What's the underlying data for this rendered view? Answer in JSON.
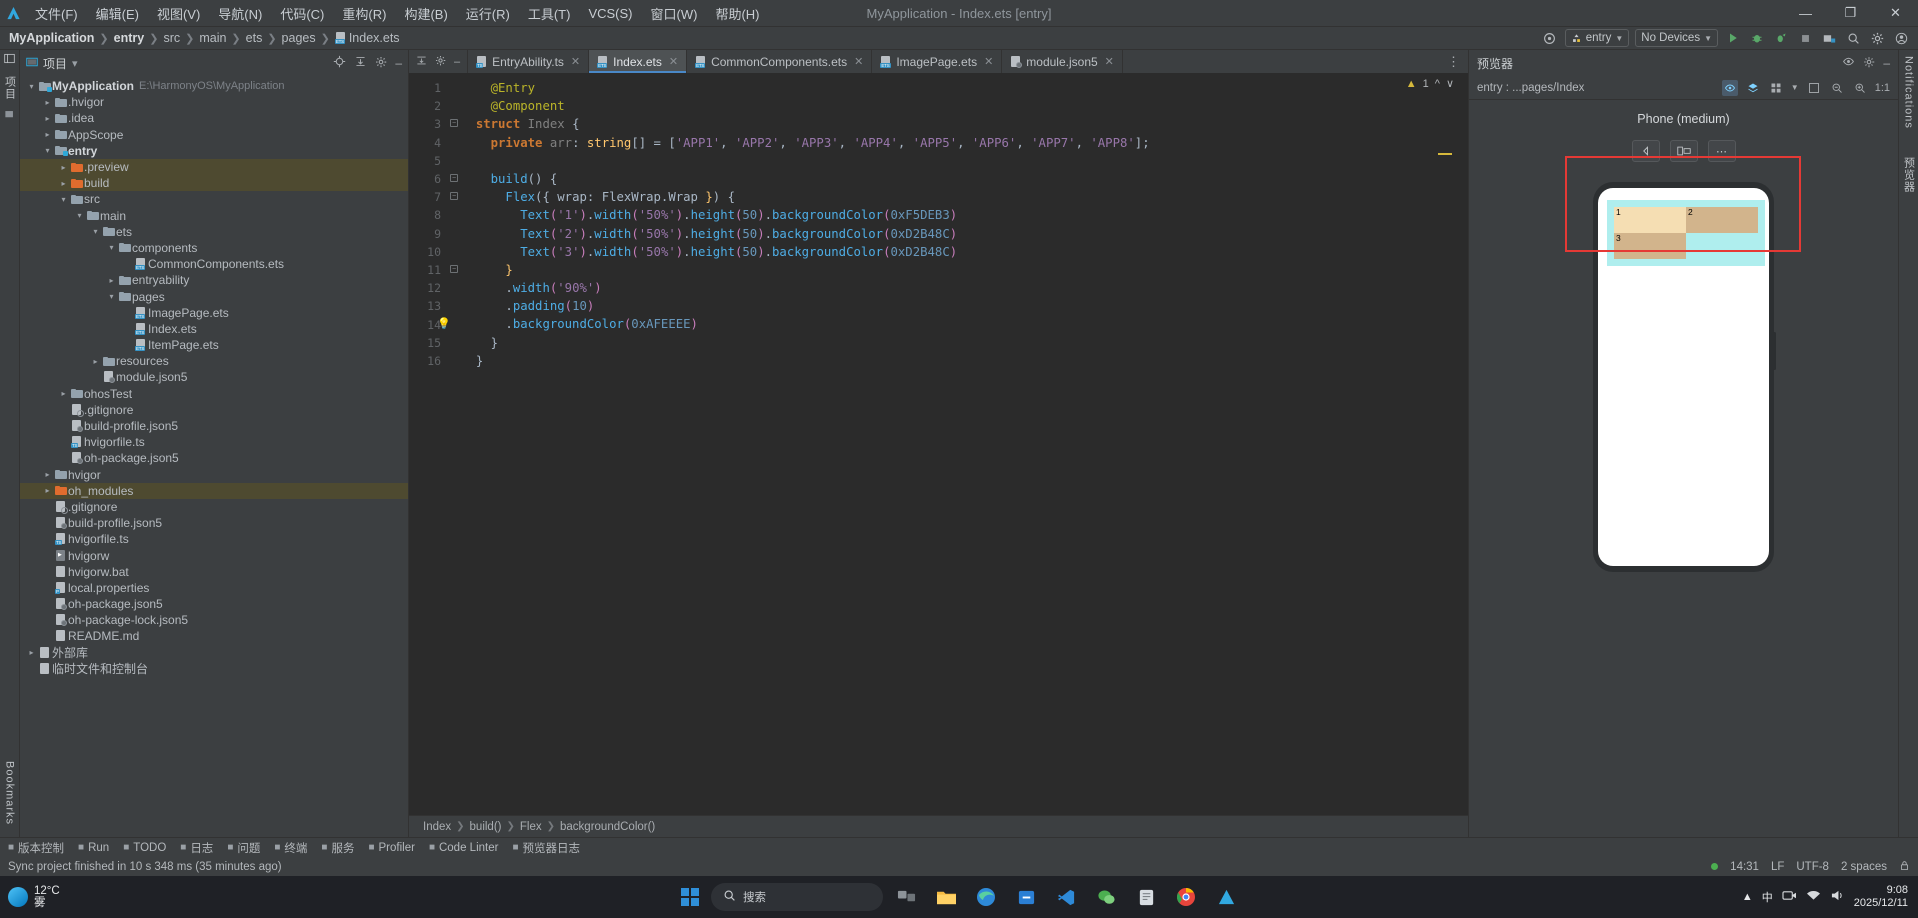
{
  "window": {
    "title": "MyApplication - Index.ets [entry]",
    "minimize": "—",
    "maximize": "❐",
    "close": "✕"
  },
  "menu": [
    {
      "label": "文件(F)"
    },
    {
      "label": "编辑(E)"
    },
    {
      "label": "视图(V)"
    },
    {
      "label": "导航(N)"
    },
    {
      "label": "代码(C)"
    },
    {
      "label": "重构(R)"
    },
    {
      "label": "构建(B)"
    },
    {
      "label": "运行(R)"
    },
    {
      "label": "工具(T)"
    },
    {
      "label": "VCS(S)"
    },
    {
      "label": "窗口(W)"
    },
    {
      "label": "帮助(H)"
    }
  ],
  "breadcrumbs": [
    "MyApplication",
    "entry",
    "src",
    "main",
    "ets",
    "pages",
    "Index.ets"
  ],
  "toolbar": {
    "target_icon": "target-icon",
    "run_config": "entry",
    "device_select": "No Devices",
    "run": "run-icon",
    "debug": "debug-icon",
    "profile": "profile-icon",
    "stop": "stop-icon",
    "device_manager": "device-manager-icon",
    "search": "search-icon",
    "settings": "gear-icon",
    "account": "account-icon"
  },
  "project_panel": {
    "title": "项目",
    "caret": "▾",
    "tree": [
      {
        "depth": 0,
        "arrow": "▾",
        "icon": "module",
        "label": "MyApplication",
        "bold": true,
        "path": "E:\\HarmonyOS\\MyApplication"
      },
      {
        "depth": 1,
        "arrow": "▸",
        "icon": "folder",
        "label": ".hvigor"
      },
      {
        "depth": 1,
        "arrow": "▸",
        "icon": "folder",
        "label": ".idea"
      },
      {
        "depth": 1,
        "arrow": "▸",
        "icon": "folder",
        "label": "AppScope"
      },
      {
        "depth": 1,
        "arrow": "▾",
        "icon": "module",
        "label": "entry",
        "bold": true
      },
      {
        "depth": 2,
        "arrow": "▸",
        "icon": "folder-orange",
        "label": ".preview",
        "highlight": true
      },
      {
        "depth": 2,
        "arrow": "▸",
        "icon": "folder-orange",
        "label": "build",
        "highlight": true
      },
      {
        "depth": 2,
        "arrow": "▾",
        "icon": "folder",
        "label": "src"
      },
      {
        "depth": 3,
        "arrow": "▾",
        "icon": "folder",
        "label": "main"
      },
      {
        "depth": 4,
        "arrow": "▾",
        "icon": "folder",
        "label": "ets"
      },
      {
        "depth": 5,
        "arrow": "▾",
        "icon": "folder",
        "label": "components"
      },
      {
        "depth": 6,
        "arrow": "",
        "icon": "ets-file",
        "label": "CommonComponents.ets"
      },
      {
        "depth": 5,
        "arrow": "▸",
        "icon": "folder",
        "label": "entryability"
      },
      {
        "depth": 5,
        "arrow": "▾",
        "icon": "folder",
        "label": "pages"
      },
      {
        "depth": 6,
        "arrow": "",
        "icon": "ets-file",
        "label": "ImagePage.ets"
      },
      {
        "depth": 6,
        "arrow": "",
        "icon": "ets-file",
        "label": "Index.ets"
      },
      {
        "depth": 6,
        "arrow": "",
        "icon": "ets-file",
        "label": "ItemPage.ets"
      },
      {
        "depth": 4,
        "arrow": "▸",
        "icon": "folder",
        "label": "resources"
      },
      {
        "depth": 4,
        "arrow": "",
        "icon": "json-file",
        "label": "module.json5"
      },
      {
        "depth": 2,
        "arrow": "▸",
        "icon": "folder",
        "label": "ohosTest"
      },
      {
        "depth": 2,
        "arrow": "",
        "icon": "gitignore-file",
        "label": ".gitignore"
      },
      {
        "depth": 2,
        "arrow": "",
        "icon": "json-file",
        "label": "build-profile.json5"
      },
      {
        "depth": 2,
        "arrow": "",
        "icon": "ts-file",
        "label": "hvigorfile.ts"
      },
      {
        "depth": 2,
        "arrow": "",
        "icon": "json-file",
        "label": "oh-package.json5"
      },
      {
        "depth": 1,
        "arrow": "▸",
        "icon": "folder",
        "label": "hvigor"
      },
      {
        "depth": 1,
        "arrow": "▸",
        "icon": "folder-orange",
        "label": "oh_modules",
        "highlight": true
      },
      {
        "depth": 1,
        "arrow": "",
        "icon": "gitignore-file",
        "label": ".gitignore"
      },
      {
        "depth": 1,
        "arrow": "",
        "icon": "json-file",
        "label": "build-profile.json5"
      },
      {
        "depth": 1,
        "arrow": "",
        "icon": "ts-file",
        "label": "hvigorfile.ts"
      },
      {
        "depth": 1,
        "arrow": "",
        "icon": "run-file",
        "label": "hvigorw"
      },
      {
        "depth": 1,
        "arrow": "",
        "icon": "bat-file",
        "label": "hvigorw.bat"
      },
      {
        "depth": 1,
        "arrow": "",
        "icon": "prop-file",
        "label": "local.properties"
      },
      {
        "depth": 1,
        "arrow": "",
        "icon": "json-file",
        "label": "oh-package.json5"
      },
      {
        "depth": 1,
        "arrow": "",
        "icon": "json-file",
        "label": "oh-package-lock.json5"
      },
      {
        "depth": 1,
        "arrow": "",
        "icon": "md-file",
        "label": "README.md"
      },
      {
        "depth": 0,
        "arrow": "▸",
        "icon": "lib",
        "label": "外部库"
      },
      {
        "depth": 0,
        "arrow": "",
        "icon": "scratch",
        "label": "临时文件和控制台"
      }
    ]
  },
  "left_rail": {
    "project_label": "项目",
    "bookmarks_label": "Bookmarks",
    "structure_icon": "structure-icon"
  },
  "editor": {
    "tabs": [
      {
        "label": "EntryAbility.ts",
        "icon": "ts-file",
        "active": false
      },
      {
        "label": "Index.ets",
        "icon": "ets-file",
        "active": true
      },
      {
        "label": "CommonComponents.ets",
        "icon": "ets-file",
        "active": false
      },
      {
        "label": "ImagePage.ets",
        "icon": "ets-file",
        "active": false
      },
      {
        "label": "module.json5",
        "icon": "json-file",
        "active": false
      }
    ],
    "warning_count": "1",
    "code_lines": [
      {
        "n": 1,
        "tokens": [
          {
            "t": "@Entry",
            "c": "an"
          }
        ],
        "indent": 2
      },
      {
        "n": 2,
        "tokens": [
          {
            "t": "@Component",
            "c": "an"
          }
        ],
        "indent": 2
      },
      {
        "n": 3,
        "tokens": [
          {
            "t": "struct ",
            "c": "kb"
          },
          {
            "t": "Index",
            "c": "gy"
          },
          {
            "t": " {",
            "c": "wh"
          }
        ],
        "indent": 1
      },
      {
        "n": 4,
        "tokens": [
          {
            "t": "private ",
            "c": "kb"
          },
          {
            "t": "arr",
            "c": "gy"
          },
          {
            "t": ": ",
            "c": "wh"
          },
          {
            "t": "string",
            "c": "ye"
          },
          {
            "t": "[] = [",
            "c": "wh"
          },
          {
            "t": "'APP1'",
            "c": "gr"
          },
          {
            "t": ", ",
            "c": "wh"
          },
          {
            "t": "'APP2'",
            "c": "gr"
          },
          {
            "t": ", ",
            "c": "wh"
          },
          {
            "t": "'APP3'",
            "c": "gr"
          },
          {
            "t": ", ",
            "c": "wh"
          },
          {
            "t": "'APP4'",
            "c": "gr"
          },
          {
            "t": ", ",
            "c": "wh"
          },
          {
            "t": "'APP5'",
            "c": "gr"
          },
          {
            "t": ", ",
            "c": "wh"
          },
          {
            "t": "'APP6'",
            "c": "gr"
          },
          {
            "t": ", ",
            "c": "wh"
          },
          {
            "t": "'APP7'",
            "c": "gr"
          },
          {
            "t": ", ",
            "c": "wh"
          },
          {
            "t": "'APP8'",
            "c": "gr"
          },
          {
            "t": "];",
            "c": "wh"
          }
        ],
        "indent": 2
      },
      {
        "n": 5,
        "tokens": [],
        "indent": 0
      },
      {
        "n": 6,
        "tokens": [
          {
            "t": "build",
            "c": "cy"
          },
          {
            "t": "() {",
            "c": "wh"
          }
        ],
        "indent": 2
      },
      {
        "n": 7,
        "tokens": [
          {
            "t": "Flex",
            "c": "cy"
          },
          {
            "t": "({ wrap: ",
            "c": "wh"
          },
          {
            "t": "FlexWrap",
            "c": "wh"
          },
          {
            "t": ".",
            "c": "wh"
          },
          {
            "t": "Wrap",
            "c": "wh"
          },
          {
            "t": " }",
            "c": "ye"
          },
          {
            "t": ") {",
            "c": "wh"
          }
        ],
        "indent": 3
      },
      {
        "n": 8,
        "tokens": [
          {
            "t": "Text",
            "c": "cy"
          },
          {
            "t": "(",
            "c": "pp"
          },
          {
            "t": "'1'",
            "c": "gr"
          },
          {
            "t": ")",
            "c": "pp"
          },
          {
            "t": ".",
            "c": "wh"
          },
          {
            "t": "width",
            "c": "cy"
          },
          {
            "t": "(",
            "c": "pp"
          },
          {
            "t": "'50%'",
            "c": "gr"
          },
          {
            "t": ")",
            "c": "pp"
          },
          {
            "t": ".",
            "c": "wh"
          },
          {
            "t": "height",
            "c": "cy"
          },
          {
            "t": "(",
            "c": "pp"
          },
          {
            "t": "50",
            "c": "bb"
          },
          {
            "t": ")",
            "c": "pp"
          },
          {
            "t": ".",
            "c": "wh"
          },
          {
            "t": "backgroundColor",
            "c": "cy"
          },
          {
            "t": "(",
            "c": "pp"
          },
          {
            "t": "0xF5DEB3",
            "c": "num"
          },
          {
            "t": ")",
            "c": "pp"
          }
        ],
        "indent": 4
      },
      {
        "n": 9,
        "tokens": [
          {
            "t": "Text",
            "c": "cy"
          },
          {
            "t": "(",
            "c": "pp"
          },
          {
            "t": "'2'",
            "c": "gr"
          },
          {
            "t": ")",
            "c": "pp"
          },
          {
            "t": ".",
            "c": "wh"
          },
          {
            "t": "width",
            "c": "cy"
          },
          {
            "t": "(",
            "c": "pp"
          },
          {
            "t": "'50%'",
            "c": "gr"
          },
          {
            "t": ")",
            "c": "pp"
          },
          {
            "t": ".",
            "c": "wh"
          },
          {
            "t": "height",
            "c": "cy"
          },
          {
            "t": "(",
            "c": "pp"
          },
          {
            "t": "50",
            "c": "bb"
          },
          {
            "t": ")",
            "c": "pp"
          },
          {
            "t": ".",
            "c": "wh"
          },
          {
            "t": "backgroundColor",
            "c": "cy"
          },
          {
            "t": "(",
            "c": "pp"
          },
          {
            "t": "0xD2B48C",
            "c": "num"
          },
          {
            "t": ")",
            "c": "pp"
          }
        ],
        "indent": 4
      },
      {
        "n": 10,
        "tokens": [
          {
            "t": "Text",
            "c": "cy"
          },
          {
            "t": "(",
            "c": "pp"
          },
          {
            "t": "'3'",
            "c": "gr"
          },
          {
            "t": ")",
            "c": "pp"
          },
          {
            "t": ".",
            "c": "wh"
          },
          {
            "t": "width",
            "c": "cy"
          },
          {
            "t": "(",
            "c": "pp"
          },
          {
            "t": "'50%'",
            "c": "gr"
          },
          {
            "t": ")",
            "c": "pp"
          },
          {
            "t": ".",
            "c": "wh"
          },
          {
            "t": "height",
            "c": "cy"
          },
          {
            "t": "(",
            "c": "pp"
          },
          {
            "t": "50",
            "c": "bb"
          },
          {
            "t": ")",
            "c": "pp"
          },
          {
            "t": ".",
            "c": "wh"
          },
          {
            "t": "backgroundColor",
            "c": "cy"
          },
          {
            "t": "(",
            "c": "pp"
          },
          {
            "t": "0xD2B48C",
            "c": "num"
          },
          {
            "t": ")",
            "c": "pp"
          }
        ],
        "indent": 4
      },
      {
        "n": 11,
        "tokens": [
          {
            "t": "}",
            "c": "ye"
          }
        ],
        "indent": 3
      },
      {
        "n": 12,
        "tokens": [
          {
            "t": ".",
            "c": "wh"
          },
          {
            "t": "width",
            "c": "cy"
          },
          {
            "t": "(",
            "c": "pp"
          },
          {
            "t": "'90%'",
            "c": "gr"
          },
          {
            "t": ")",
            "c": "pp"
          }
        ],
        "indent": 3
      },
      {
        "n": 13,
        "tokens": [
          {
            "t": ".",
            "c": "wh"
          },
          {
            "t": "padding",
            "c": "cy"
          },
          {
            "t": "(",
            "c": "pp"
          },
          {
            "t": "10",
            "c": "bb"
          },
          {
            "t": ")",
            "c": "pp"
          }
        ],
        "indent": 3
      },
      {
        "n": 14,
        "tokens": [
          {
            "t": ".",
            "c": "wh"
          },
          {
            "t": "backgroundColor",
            "c": "cy"
          },
          {
            "t": "(",
            "c": "pp"
          },
          {
            "t": "0xAFEEEE",
            "c": "num"
          },
          {
            "t": ")",
            "c": "pp"
          }
        ],
        "indent": 3,
        "bulb": true
      },
      {
        "n": 15,
        "tokens": [
          {
            "t": "}",
            "c": "wh"
          }
        ],
        "indent": 2
      },
      {
        "n": 16,
        "tokens": [
          {
            "t": "}",
            "c": "wh"
          }
        ],
        "indent": 1
      }
    ],
    "status_breadcrumb": [
      "Index",
      "build()",
      "Flex",
      "backgroundColor()"
    ]
  },
  "previewer": {
    "title": "预览器",
    "path": "entry : ...pages/Index",
    "device_label": "Phone (medium)",
    "controls": {
      "rotate": "rotate-icon",
      "orientation": "orientation-icon",
      "more": "⋯"
    },
    "zoom_label": "1:1",
    "preview_cells": [
      {
        "label": "1",
        "color": "#F5DEB3",
        "width": "50%"
      },
      {
        "label": "2",
        "color": "#D2B48C",
        "width": "50%"
      },
      {
        "label": "3",
        "color": "#D2B48C",
        "width": "50%"
      }
    ],
    "container_color": "#AFEEEE"
  },
  "toolwindows": [
    {
      "icon": "vcs-icon",
      "label": "版本控制"
    },
    {
      "icon": "run-icon",
      "label": "Run"
    },
    {
      "icon": "todo-icon",
      "label": "TODO"
    },
    {
      "icon": "log-icon",
      "label": "日志"
    },
    {
      "icon": "problem-icon",
      "label": "问题"
    },
    {
      "icon": "terminal-icon",
      "label": "终端"
    },
    {
      "icon": "service-icon",
      "label": "服务"
    },
    {
      "icon": "profiler-icon",
      "label": "Profiler"
    },
    {
      "icon": "linter-icon",
      "label": "Code Linter"
    },
    {
      "icon": "preview-log-icon",
      "label": "预览器日志"
    }
  ],
  "statusbar": {
    "message": "Sync project finished in 10 s 348 ms (35 minutes ago)",
    "time": "14:31",
    "line_sep": "LF",
    "encoding": "UTF-8",
    "indent": "2 spaces",
    "lock_icon": "lock-icon"
  },
  "taskbar": {
    "weather_temp": "12°C",
    "weather_desc": "雾",
    "start": "start-icon",
    "search_placeholder": "搜索",
    "apps": [
      "task-view-icon",
      "file-explorer-icon",
      "edge-icon",
      "store-icon",
      "vscode-icon",
      "wechat-icon",
      "notes-icon",
      "chrome-icon",
      "deveco-icon"
    ],
    "tray": [
      "chevron-up-icon",
      "ime-cn-icon",
      "camera-icon",
      "network-icon",
      "volume-icon"
    ],
    "clock_time": "9:08",
    "clock_date": "2025/12/11"
  },
  "colors": {
    "accent": "#4a88c7",
    "warning": "#d6b93c",
    "highlight_row": "#4e4a30",
    "red_box": "#e53935"
  }
}
